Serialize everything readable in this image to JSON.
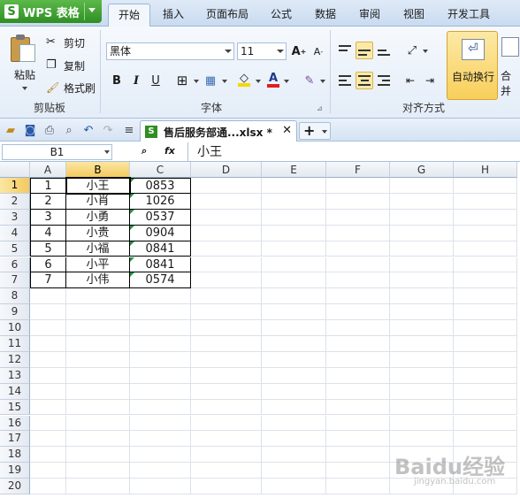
{
  "app": {
    "title": "WPS 表格",
    "logo_letter": "S"
  },
  "menu_tabs": [
    {
      "label": "开始",
      "active": true
    },
    {
      "label": "插入"
    },
    {
      "label": "页面布局"
    },
    {
      "label": "公式"
    },
    {
      "label": "数据"
    },
    {
      "label": "审阅"
    },
    {
      "label": "视图"
    },
    {
      "label": "开发工具"
    }
  ],
  "ribbon": {
    "clipboard": {
      "paste": "粘贴",
      "cut": "剪切",
      "copy": "复制",
      "format_painter": "格式刷",
      "group_label": "剪贴板"
    },
    "font": {
      "font_name": "黑体",
      "font_size": "11",
      "group_label": "字体",
      "bold": "B",
      "italic": "I",
      "underline": "U"
    },
    "alignment": {
      "wrap_text": "自动换行",
      "merge": "合并",
      "group_label": "对齐方式"
    }
  },
  "document": {
    "tab_name": "售后服务部通...xlsx *"
  },
  "formula_bar": {
    "name_box": "B1",
    "fx": "fx",
    "content": "小王"
  },
  "columns": [
    "A",
    "B",
    "C",
    "D",
    "E",
    "F",
    "G",
    "H"
  ],
  "rows": [
    "1",
    "2",
    "3",
    "4",
    "5",
    "6",
    "7",
    "8",
    "9",
    "10",
    "11",
    "12",
    "13",
    "14",
    "15",
    "16",
    "17",
    "18",
    "19",
    "20"
  ],
  "selected_cell": {
    "column": "B",
    "row": "1"
  },
  "table": [
    {
      "a": "1",
      "b": "小王",
      "c": "0853"
    },
    {
      "a": "2",
      "b": "小肖",
      "c": "1026"
    },
    {
      "a": "3",
      "b": "小勇",
      "c": "0537"
    },
    {
      "a": "4",
      "b": "小贵",
      "c": "0904"
    },
    {
      "a": "5",
      "b": "小福",
      "c": "0841"
    },
    {
      "a": "6",
      "b": "小平",
      "c": "0841"
    },
    {
      "a": "7",
      "b": "小伟",
      "c": "0574"
    }
  ],
  "watermark": {
    "main": "Baidu经验",
    "sub": "jingyan.baidu.com"
  },
  "colors": {
    "accent_green": "#2f8f23",
    "active_header": "#f4c960",
    "text_number_marker": "#1f9a3a"
  }
}
